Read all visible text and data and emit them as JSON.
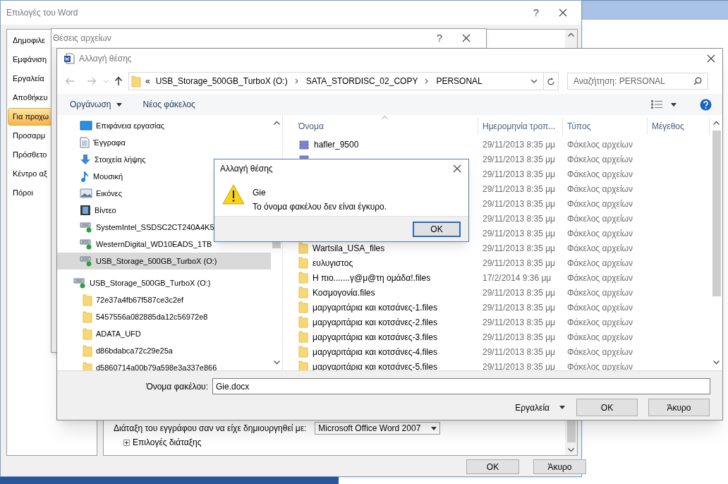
{
  "word_options": {
    "title": "Επιλογές του Word",
    "help": "?",
    "categories": [
      {
        "label": "Δημοφιλε",
        "selected": false
      },
      {
        "label": "Εμφάνιση",
        "selected": false
      },
      {
        "label": "Εργαλεία",
        "selected": false
      },
      {
        "label": "Αποθήκευ",
        "selected": false
      },
      {
        "label": "Για προχω",
        "selected": true
      },
      {
        "label": "Προσαρμ",
        "selected": false
      },
      {
        "label": "Πρόσθετο",
        "selected": false
      },
      {
        "label": "Κέντρο αξ",
        "selected": false
      },
      {
        "label": "Πόροι",
        "selected": false
      }
    ],
    "layout_label": "Διάταξη του εγγράφου σαν να είχε δημιουργηθεί με:",
    "layout_value": "Microsoft Office Word 2007",
    "layout_options": "Επιλογές διάταξης",
    "buttons": [
      "OK",
      "Άκυρο"
    ]
  },
  "file_locations": {
    "title": "Θέσεις αρχείων",
    "help": "?"
  },
  "change_location": {
    "title": "Αλλαγή θέσης",
    "path_prefix": "«",
    "path": [
      "USB_Storage_500GB_TurboX (O:)",
      "SATA_STORDISC_02_COPY",
      "PERSONAL"
    ],
    "search_placeholder": "Αναζήτηση: PERSONAL",
    "toolbar": [
      "Οργάνωση",
      "Νέος φάκελος"
    ],
    "nav_tree": [
      {
        "label": "Επιφάνεια εργασίας",
        "kind": "desktop",
        "selected": false
      },
      {
        "label": "Έγγραφα",
        "kind": "documents",
        "selected": false
      },
      {
        "label": "Στοιχεία λήψης",
        "kind": "downloads",
        "selected": false
      },
      {
        "label": "Μουσική",
        "kind": "music",
        "selected": false
      },
      {
        "label": "Εικόνες",
        "kind": "pictures",
        "selected": false
      },
      {
        "label": "Βίντεο",
        "kind": "video",
        "selected": false
      },
      {
        "label": "SystemIntel_SSDSC2CT240A4K5",
        "kind": "drive",
        "selected": false
      },
      {
        "label": "WesternDigital_WD10EADS_1TB",
        "kind": "drive",
        "selected": false
      },
      {
        "label": "USB_Storage_500GB_TurboX (O:)",
        "kind": "drive",
        "selected": true
      },
      {
        "label": "USB_Storage_500GB_TurboX (O:)",
        "kind": "drive",
        "selected": false,
        "children": [
          {
            "label": "72e37a4fb67f587ce3c2ef",
            "kind": "folder",
            "selected": false
          },
          {
            "label": "5457556a082885da12c56972e8",
            "kind": "folder",
            "selected": false
          },
          {
            "label": "ADATA_UFD",
            "kind": "folder",
            "selected": false
          },
          {
            "label": "d86bdabca72c29e25a",
            "kind": "folder",
            "selected": false
          },
          {
            "label": "d5860714a00b79a598e3a337e866",
            "kind": "folder",
            "selected": false
          }
        ]
      }
    ],
    "columns": [
      {
        "label": "Όνομα",
        "sorted": true
      },
      {
        "label": "Ημερομηνία τροπ...",
        "sorted": false
      },
      {
        "label": "Τύπος",
        "sorted": false
      },
      {
        "label": "Μέγεθος",
        "sorted": false
      }
    ],
    "rows": [
      {
        "kind": "stack",
        "name": "hafler_9500",
        "date": "29/11/2013 8:35 μμ",
        "type": "Φάκελος αρχείων"
      },
      {
        "kind": "stack",
        "date": "29/11/2013 8:35 μμ",
        "type": "Φάκελος αρχείων"
      },
      {
        "date": "29/11/2013 8:35 μμ",
        "type": "Φάκελος αρχείων"
      },
      {
        "date": "29/11/2013 8:35 μμ",
        "type": "Φάκελος αρχείων"
      },
      {
        "date": "29/11/2013 8:35 μμ",
        "type": "Φάκελος αρχείων"
      },
      {
        "date": "29/11/2013 8:35 μμ",
        "type": "Φάκελος αρχείων"
      },
      {
        "date": "29/11/2013 8:35 μμ",
        "type": "Φάκελος αρχείων"
      },
      {
        "kind": "folder",
        "name": "Wartsila_USA_files",
        "date": "29/11/2013 8:35 μμ",
        "type": "Φάκελος αρχείων"
      },
      {
        "kind": "folder",
        "name": "ευλυγιστος",
        "date": "29/11/2013 8:35 μμ",
        "type": "Φάκελος αρχείων"
      },
      {
        "kind": "folder",
        "name": "Η πιο.......γ@μ@τη ομάδα!.files",
        "date": "17/2/2014 9:36 μμ",
        "type": "Φάκελος αρχείων"
      },
      {
        "kind": "folder",
        "name": "Κοσμογονία.files",
        "date": "29/11/2013 8:35 μμ",
        "type": "Φάκελος αρχείων"
      },
      {
        "kind": "folder",
        "name": "μαργαριτάρια και κοτσάνες-1.files",
        "date": "29/11/2013 8:35 μμ",
        "type": "Φάκελος αρχείων"
      },
      {
        "kind": "folder",
        "name": "μαργαριτάρια και κοτσάνες-2.files",
        "date": "29/11/2013 8:35 μμ",
        "type": "Φάκελος αρχείων"
      },
      {
        "kind": "folder",
        "name": "μαργαριτάρια και κοτσάνες-3.files",
        "date": "29/11/2013 8:35 μμ",
        "type": "Φάκελος αρχείων"
      },
      {
        "kind": "folder",
        "name": "μαργαριτάρια και κοτσάνες-4.files",
        "date": "29/11/2013 8:35 μμ",
        "type": "Φάκελος αρχείων"
      },
      {
        "kind": "folder",
        "name": "μαργαριτάρια και κοτσάνες-5.files",
        "date": "29/11/2013 8:35 μμ",
        "type": "Φάκελος αρχείων"
      }
    ],
    "filename_label": "Όνομα φακέλου:",
    "filename_value": "Gie.docx",
    "tools": "Εργαλεία",
    "buttons": [
      "OK",
      "Άκυρο"
    ]
  },
  "alert": {
    "title": "Αλλαγή θέσης",
    "heading": "Gie",
    "message": "Το όνομα φακέλου δεν είναι έγκυρο.",
    "button": "OK"
  }
}
